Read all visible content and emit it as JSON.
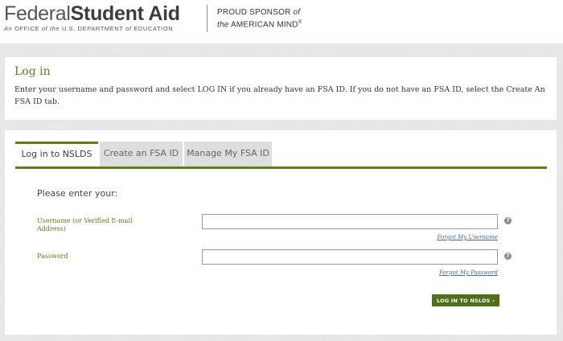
{
  "header": {
    "brand_part1": "Federal",
    "brand_part2": "Student Aid",
    "subtitle_an": "An",
    "subtitle_office": "OFFICE",
    "subtitle_of1": "of",
    "subtitle_the": "the",
    "subtitle_dept": "U.S. DEPARTMENT",
    "subtitle_of2": "of",
    "subtitle_edu": "EDUCATION",
    "sponsor_line1": "PROUD SPONSOR",
    "sponsor_of": "of",
    "sponsor_the": "the",
    "sponsor_line2": "AMERICAN MIND",
    "sponsor_reg": "®"
  },
  "intro": {
    "title": "Log in",
    "text": "Enter your username and password and select LOG IN if you already have an FSA ID. If you do not have an FSA ID, select the Create An FSA ID tab."
  },
  "tabs": [
    {
      "label": "Log in to NSLDS",
      "active": true
    },
    {
      "label": "Create an FSA ID",
      "active": false
    },
    {
      "label": "Manage My FSA ID",
      "active": false
    }
  ],
  "form": {
    "prompt": "Please enter your:",
    "username_label": "Username (or Verified E-mail Address)",
    "username_value": "",
    "forgot_username": "Forgot My Username",
    "password_label": "Password",
    "password_value": "",
    "forgot_password": "Forgot My Password",
    "help_glyph": "?",
    "submit_label": "LOG IN TO NSLDS ›"
  },
  "colors": {
    "accent_green": "#5e7f12",
    "label_green": "#5b7f1a",
    "button_green": "#4f6f1b",
    "link_blue": "#4b6a8a"
  }
}
